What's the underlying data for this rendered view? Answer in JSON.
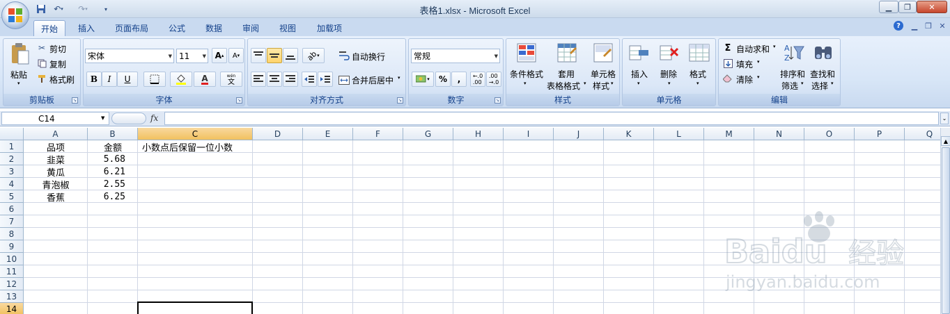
{
  "window": {
    "title": "表格1.xlsx - Microsoft Excel"
  },
  "quick_access": {
    "save_icon": "save-icon",
    "undo_icon": "undo-icon",
    "redo_icon": "redo-icon"
  },
  "tabs": [
    {
      "label": "开始",
      "active": true
    },
    {
      "label": "插入"
    },
    {
      "label": "页面布局"
    },
    {
      "label": "公式"
    },
    {
      "label": "数据"
    },
    {
      "label": "审阅"
    },
    {
      "label": "视图"
    },
    {
      "label": "加载项"
    }
  ],
  "ribbon": {
    "clipboard": {
      "label": "剪贴板",
      "paste": "粘贴",
      "cut": "剪切",
      "copy": "复制",
      "format_painter": "格式刷"
    },
    "font": {
      "label": "字体",
      "font_name": "宋体",
      "font_size": "11",
      "bold": "B",
      "italic": "I",
      "underline": "U",
      "phonetic": "wén"
    },
    "alignment": {
      "label": "对齐方式",
      "wrap_text": "自动换行",
      "merge_center": "合并后居中"
    },
    "number": {
      "label": "数字",
      "format": "常规",
      "percent": "%",
      "comma": ","
    },
    "styles": {
      "label": "样式",
      "conditional": "条件格式",
      "table_format_1": "套用",
      "table_format_2": "表格格式",
      "cell_styles_1": "单元格",
      "cell_styles_2": "样式"
    },
    "cells": {
      "label": "单元格",
      "insert": "插入",
      "delete": "删除",
      "format": "格式"
    },
    "editing": {
      "label": "编辑",
      "autosum": "自动求和",
      "fill": "填充",
      "clear": "清除",
      "sort_1": "排序和",
      "sort_2": "筛选",
      "find_1": "查找和",
      "find_2": "选择"
    }
  },
  "formula_bar": {
    "name_box": "C14",
    "fx": "fx",
    "formula": ""
  },
  "sheet": {
    "columns": [
      "A",
      "B",
      "C",
      "D",
      "E",
      "F",
      "G",
      "H",
      "I",
      "J",
      "K",
      "L",
      "M",
      "N",
      "O",
      "P",
      "Q"
    ],
    "rows": [
      "1",
      "2",
      "3",
      "4",
      "5",
      "6",
      "7",
      "8",
      "9",
      "10",
      "11",
      "12",
      "13",
      "14"
    ],
    "selected_column": "C",
    "selected_row": "14",
    "cells": {
      "A1": "品项",
      "B1": "金额",
      "C1": "小数点后保留一位小数",
      "A2": "韭菜",
      "B2": "5.68",
      "A3": "黄瓜",
      "B3": "6.21",
      "A4": "青泡椒",
      "B4": "2.55",
      "A5": "香蕉",
      "B5": "6.25"
    }
  },
  "watermark": {
    "brand": "Baidu",
    "text": "经验",
    "url": "jingyan.baidu.com"
  }
}
